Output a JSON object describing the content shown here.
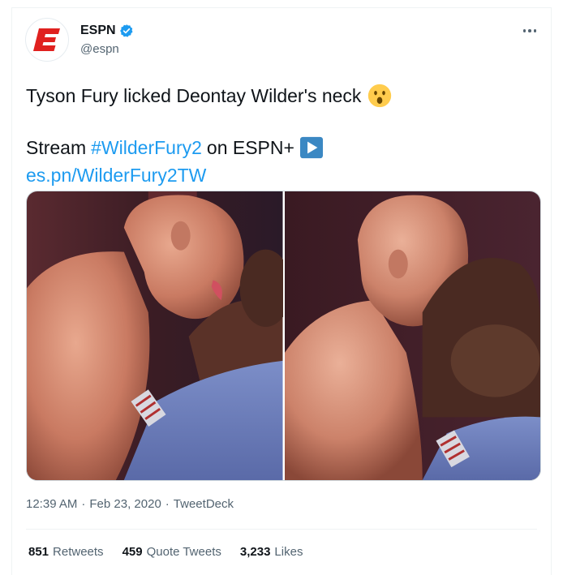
{
  "author": {
    "display_name": "ESPN",
    "handle": "@espn",
    "verified": true,
    "avatar_icon": "espn-logo-icon"
  },
  "tweet": {
    "line1": "Tyson Fury licked Deontay Wilder's neck",
    "line1_emoji": "hushed-face-emoji",
    "line2_prefix": "Stream",
    "hashtag": "#WilderFury2",
    "line2_suffix": "on ESPN+",
    "line2_emoji": "play-button-emoji",
    "link": "es.pn/WilderFury2TW"
  },
  "media": {
    "count": 2,
    "items": [
      "photo-fury-licking-neck-1",
      "photo-fury-licking-neck-2"
    ]
  },
  "meta": {
    "time": "12:39 AM",
    "date": "Feb 23, 2020",
    "source": "TweetDeck",
    "separator": "·"
  },
  "stats": {
    "retweets_count": "851",
    "retweets_label": "Retweets",
    "quotes_count": "459",
    "quotes_label": "Quote Tweets",
    "likes_count": "3,233",
    "likes_label": "Likes"
  },
  "colors": {
    "brand_red": "#e0211f",
    "link_blue": "#1d9bf0",
    "verified_blue": "#1d9bf0",
    "secondary_text": "#536471"
  }
}
